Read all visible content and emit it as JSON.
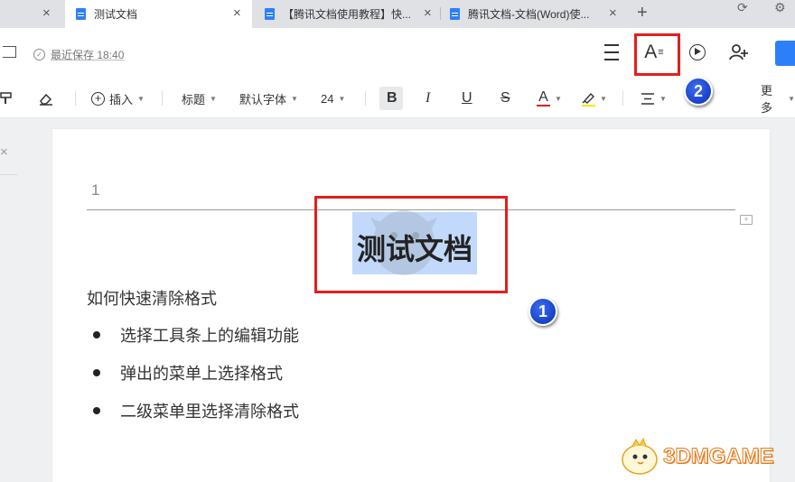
{
  "tabs": [
    {
      "label": "测试文档",
      "active": true
    },
    {
      "label": "【腾讯文档使用教程】快...",
      "active": false
    },
    {
      "label": "腾讯文档-文档(Word)使...",
      "active": false
    }
  ],
  "header": {
    "save_status": "最近保存 18:40"
  },
  "toolbar": {
    "insert": "插入",
    "heading": "标题",
    "font": "默认字体",
    "font_size": "24",
    "bold": "B",
    "italic": "I",
    "underline": "U",
    "strike": "S",
    "font_color": "A",
    "more": "更多"
  },
  "document": {
    "header_number": "1",
    "title": "测试文档",
    "paragraph": "如何快速清除格式",
    "bullets": [
      "选择工具条上的编辑功能",
      "弹出的菜单上选择格式",
      "二级菜单里选择清除格式"
    ]
  },
  "annotations": {
    "badge_1": "1",
    "badge_2": "2"
  },
  "watermark": "3DMGAME",
  "colors": {
    "accent": "#2d7ff9",
    "highlight": "#c2d9fb",
    "annotation_red": "#e21f1f",
    "badge_blue": "#0a2fb8",
    "font_color_bar": "#e21f1f",
    "highlight_bar": "#f5e900"
  },
  "icons": [
    "close-icon",
    "doc-icon",
    "plus-icon",
    "refresh-icon",
    "settings-icon",
    "exit-icon",
    "check-circle-icon",
    "menu-icon",
    "text-style-icon",
    "play-icon",
    "add-user-icon",
    "format-painter-icon",
    "eraser-icon",
    "insert-plus-icon",
    "highlighter-icon",
    "align-icon",
    "comment-icon"
  ]
}
